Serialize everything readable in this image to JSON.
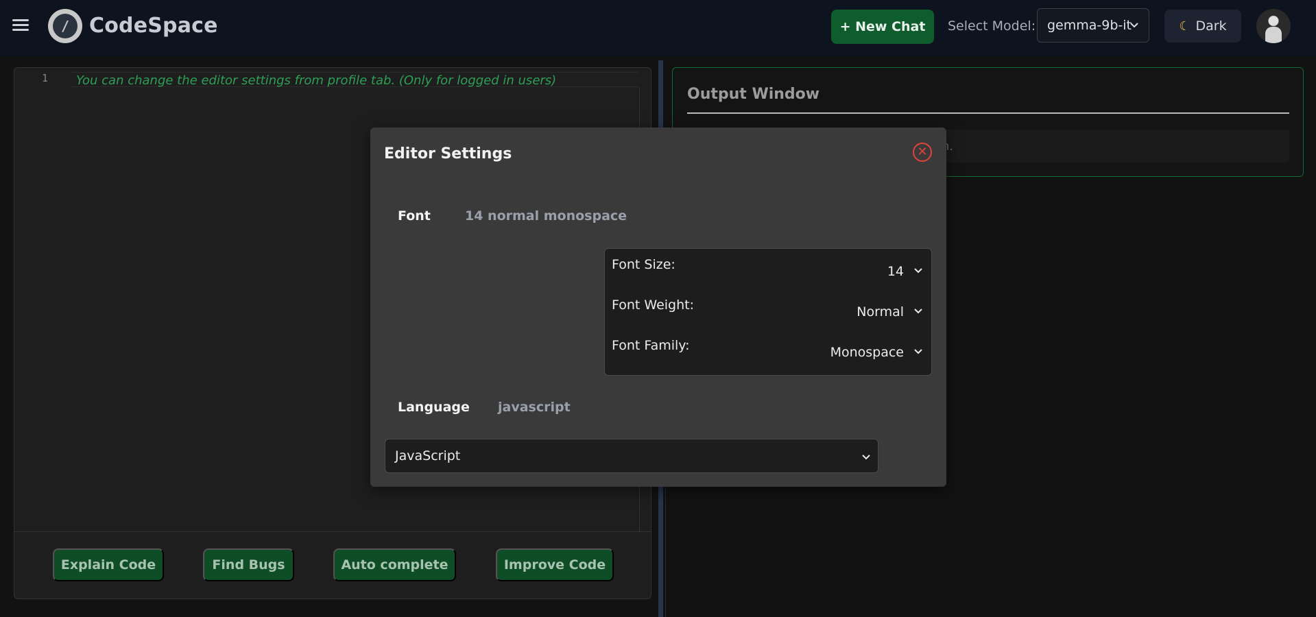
{
  "header": {
    "brand": "CodeSpace",
    "new_chat_label": "+ New Chat",
    "model_label": "Select Model:",
    "model_selected": "gemma-9b-it",
    "theme_label": "Dark",
    "theme_icon": "moon-icon"
  },
  "editor": {
    "line_number": "1",
    "comment": "You can change the editor settings from profile tab. (Only for logged in users)",
    "actions": [
      "Explain Code",
      "Find Bugs",
      "Auto complete",
      "Improve Code"
    ]
  },
  "output": {
    "title": "Output Window",
    "placeholder_visible": "on."
  },
  "modal": {
    "title": "Editor Settings",
    "font_label": "Font",
    "font_summary": "14 normal monospace",
    "font_size_label": "Font Size:",
    "font_size_value": "14",
    "font_weight_label": "Font Weight:",
    "font_weight_value": "Normal",
    "font_family_label": "Font Family:",
    "font_family_value": "Monospace",
    "language_label": "Language",
    "language_summary": "javascript",
    "language_selected": "JavaScript"
  },
  "colors": {
    "accent_green": "#0f5c2c",
    "comment_green": "#2e9f55",
    "close_red": "#e0433b",
    "header_bg": "#0e1320"
  }
}
